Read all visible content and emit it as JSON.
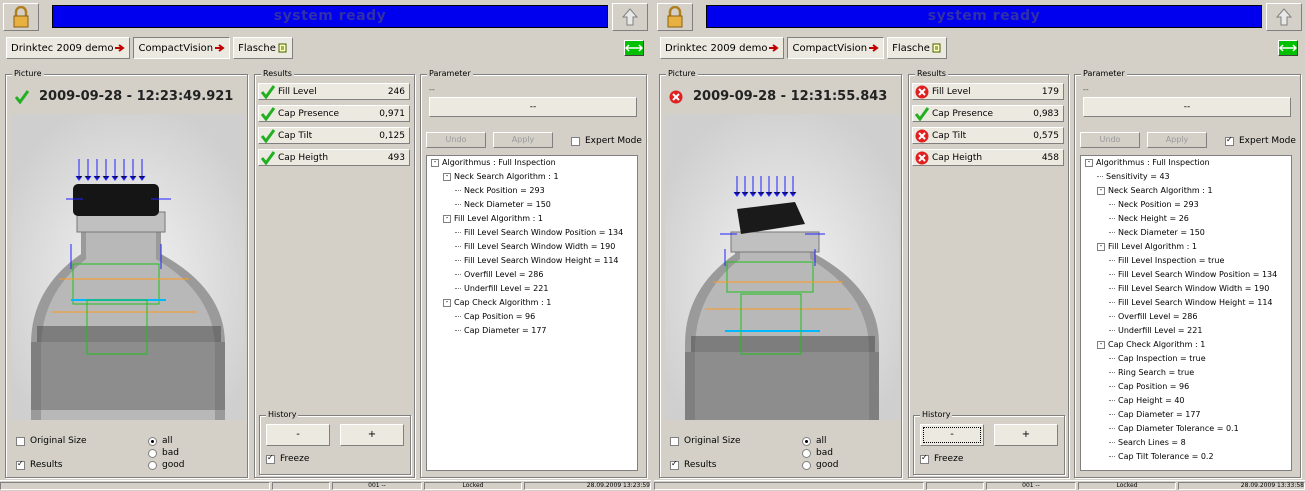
{
  "left": {
    "status": "system ready",
    "breadcrumbs": [
      "Drinktec 2009 demo",
      "CompactVision",
      "Flasche"
    ],
    "picture_title": "Picture",
    "timestamp": "2009-09-28 - 12:23:49.921",
    "ok": true,
    "results_title": "Results",
    "results": [
      {
        "label": "Fill Level",
        "value": "246",
        "ok": true
      },
      {
        "label": "Cap Presence",
        "value": "0,971",
        "ok": true
      },
      {
        "label": "Cap Tilt",
        "value": "0,125",
        "ok": true
      },
      {
        "label": "Cap Heigth",
        "value": "493",
        "ok": true
      }
    ],
    "parameter_title": "Parameter",
    "param_sub": "--",
    "param_select": "--",
    "undo": "Undo",
    "apply": "Apply",
    "expert_mode": "Expert Mode",
    "expert_checked": false,
    "tree": [
      {
        "d": 0,
        "t": "Algorithmus : Full Inspection",
        "e": true
      },
      {
        "d": 1,
        "t": "Neck Search Algorithm : 1",
        "e": true
      },
      {
        "d": 2,
        "t": "Neck Position = 293"
      },
      {
        "d": 2,
        "t": "Neck Diameter = 150"
      },
      {
        "d": 1,
        "t": "Fill Level Algorithm : 1",
        "e": true
      },
      {
        "d": 2,
        "t": "Fill Level Search Window Position = 134"
      },
      {
        "d": 2,
        "t": "Fill Level Search Window Width = 190"
      },
      {
        "d": 2,
        "t": "Fill Level Search Window Height = 114"
      },
      {
        "d": 2,
        "t": "Overfill Level = 286"
      },
      {
        "d": 2,
        "t": "Underfill Level = 221"
      },
      {
        "d": 1,
        "t": "Cap Check Algorithm : 1",
        "e": true
      },
      {
        "d": 2,
        "t": "Cap Position = 96"
      },
      {
        "d": 2,
        "t": "Cap Diameter = 177"
      }
    ],
    "original_size": "Original Size",
    "results_chk": "Results",
    "r_all": "all",
    "r_bad": "bad",
    "r_good": "good",
    "history_title": "History",
    "minus": "-",
    "plus": "+",
    "freeze": "Freeze",
    "sb_count": "001 --",
    "sb_state": "Locked",
    "sb_date": "28.09.2009 13:23:59"
  },
  "right": {
    "status": "system ready",
    "breadcrumbs": [
      "Drinktec 2009 demo",
      "CompactVision",
      "Flasche"
    ],
    "picture_title": "Picture",
    "timestamp": "2009-09-28 - 12:31:55.843",
    "ok": false,
    "results_title": "Results",
    "results": [
      {
        "label": "Fill Level",
        "value": "179",
        "ok": false
      },
      {
        "label": "Cap Presence",
        "value": "0,983",
        "ok": true
      },
      {
        "label": "Cap Tilt",
        "value": "0,575",
        "ok": false
      },
      {
        "label": "Cap Heigth",
        "value": "458",
        "ok": false
      }
    ],
    "parameter_title": "Parameter",
    "param_sub": "--",
    "param_select": "--",
    "undo": "Undo",
    "apply": "Apply",
    "expert_mode": "Expert Mode",
    "expert_checked": true,
    "tree": [
      {
        "d": 0,
        "t": "Algorithmus : Full Inspection",
        "e": true
      },
      {
        "d": 1,
        "t": "Sensitivity = 43"
      },
      {
        "d": 1,
        "t": "Neck Search Algorithm : 1",
        "e": true
      },
      {
        "d": 2,
        "t": "Neck Position = 293"
      },
      {
        "d": 2,
        "t": "Neck Height = 26"
      },
      {
        "d": 2,
        "t": "Neck Diameter = 150"
      },
      {
        "d": 1,
        "t": "Fill Level Algorithm : 1",
        "e": true
      },
      {
        "d": 2,
        "t": "Fill Level Inspection = true"
      },
      {
        "d": 2,
        "t": "Fill Level Search Window Position = 134"
      },
      {
        "d": 2,
        "t": "Fill Level Search Window Width = 190"
      },
      {
        "d": 2,
        "t": "Fill Level Search Window Height = 114"
      },
      {
        "d": 2,
        "t": "Overfill Level = 286"
      },
      {
        "d": 2,
        "t": "Underfill Level = 221"
      },
      {
        "d": 1,
        "t": "Cap Check Algorithm : 1",
        "e": true
      },
      {
        "d": 2,
        "t": "Cap Inspection = true"
      },
      {
        "d": 2,
        "t": "Ring Search = true"
      },
      {
        "d": 2,
        "t": "Cap Position = 96"
      },
      {
        "d": 2,
        "t": "Cap Height = 40"
      },
      {
        "d": 2,
        "t": "Cap Diameter = 177"
      },
      {
        "d": 2,
        "t": "Cap Diameter Tolerance = 0.1"
      },
      {
        "d": 2,
        "t": "Search Lines = 8"
      },
      {
        "d": 2,
        "t": "Cap Tilt Tolerance = 0.2"
      }
    ],
    "original_size": "Original Size",
    "results_chk": "Results",
    "r_all": "all",
    "r_bad": "bad",
    "r_good": "good",
    "history_title": "History",
    "minus": "-",
    "plus": "+",
    "freeze": "Freeze",
    "sb_count": "001 --",
    "sb_state": "Locked",
    "sb_date": "28.09.2009 13:33:58"
  },
  "colors": {
    "status_bg": "#0000ee",
    "ok": "#22b022",
    "bad": "#e02020",
    "nav": "#00c000"
  }
}
